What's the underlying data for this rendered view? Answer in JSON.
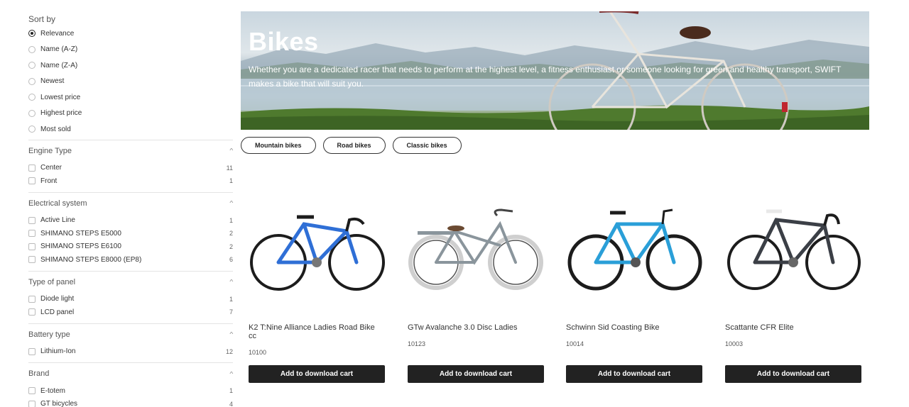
{
  "sort": {
    "title": "Sort by",
    "options": [
      {
        "label": "Relevance",
        "checked": true
      },
      {
        "label": "Name (A-Z)",
        "checked": false
      },
      {
        "label": "Name (Z-A)",
        "checked": false
      },
      {
        "label": "Newest",
        "checked": false
      },
      {
        "label": "Lowest price",
        "checked": false
      },
      {
        "label": "Highest price",
        "checked": false
      },
      {
        "label": "Most sold",
        "checked": false
      }
    ]
  },
  "filters": [
    {
      "title": "Engine Type",
      "items": [
        {
          "label": "Center",
          "count": "11"
        },
        {
          "label": "Front",
          "count": "1"
        }
      ]
    },
    {
      "title": "Electrical system",
      "items": [
        {
          "label": "Active Line",
          "count": "1"
        },
        {
          "label": "SHIMANO STEPS E5000",
          "count": "2"
        },
        {
          "label": "SHIMANO STEPS E6100",
          "count": "2"
        },
        {
          "label": "SHIMANO STEPS E8000 (EP8)",
          "count": "6"
        }
      ]
    },
    {
      "title": "Type of panel",
      "items": [
        {
          "label": "Diode light",
          "count": "1"
        },
        {
          "label": "LCD panel",
          "count": "7"
        }
      ]
    },
    {
      "title": "Battery type",
      "items": [
        {
          "label": "Lithium-Ion",
          "count": "12"
        }
      ]
    },
    {
      "title": "Brand",
      "items": [
        {
          "label": "E-totem",
          "count": "1"
        },
        {
          "label": "GT bicycles",
          "count": "4"
        }
      ]
    }
  ],
  "hero": {
    "title": "Bikes",
    "description": "Whether you are a dedicated racer that needs to perform at the highest level, a fitness enthusiast or someone looking for green and healthy transport, SWIFT makes a bike that will suit you."
  },
  "categories": [
    "Mountain bikes",
    "Road bikes",
    "Classic bikes"
  ],
  "products": [
    {
      "name": "K2 T:Nine Alliance Ladies Road Bike cc",
      "sku": "10100",
      "button": "Add to download cart",
      "frame_color": "#2f6fd6"
    },
    {
      "name": "GTw Avalanche 3.0 Disc Ladies",
      "sku": "10123",
      "button": "Add to download cart",
      "frame_color": "#8a959c"
    },
    {
      "name": "Schwinn Sid Coasting Bike",
      "sku": "10014",
      "button": "Add to download cart",
      "frame_color": "#2a9fd8"
    },
    {
      "name": "Scattante CFR Elite",
      "sku": "10003",
      "button": "Add to download cart",
      "frame_color": "#3b3f46"
    }
  ]
}
